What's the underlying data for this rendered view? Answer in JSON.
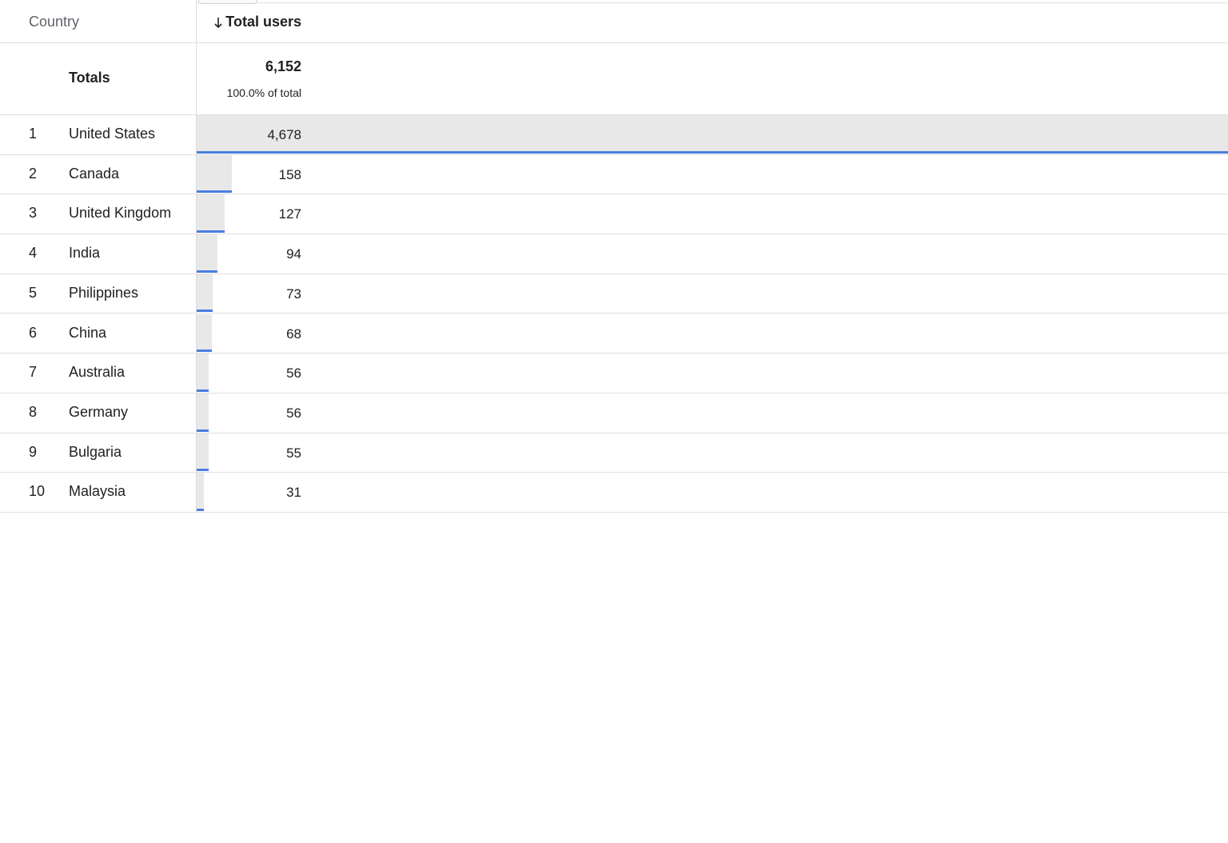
{
  "header": {
    "dimension_label": "Country",
    "metric_label": "Total users",
    "sort_icon": "arrow-down-icon"
  },
  "totals": {
    "label": "Totals",
    "value": "6,152",
    "percent_label": "100.0% of total"
  },
  "rows": [
    {
      "rank": "1",
      "country": "United States",
      "value": "4,678",
      "users": 4678
    },
    {
      "rank": "2",
      "country": "Canada",
      "value": "158",
      "users": 158
    },
    {
      "rank": "3",
      "country": "United Kingdom",
      "value": "127",
      "users": 127
    },
    {
      "rank": "4",
      "country": "India",
      "value": "94",
      "users": 94
    },
    {
      "rank": "5",
      "country": "Philippines",
      "value": "73",
      "users": 73
    },
    {
      "rank": "6",
      "country": "China",
      "value": "68",
      "users": 68
    },
    {
      "rank": "7",
      "country": "Australia",
      "value": "56",
      "users": 56
    },
    {
      "rank": "8",
      "country": "Germany",
      "value": "56",
      "users": 56
    },
    {
      "rank": "9",
      "country": "Bulgaria",
      "value": "55",
      "users": 55
    },
    {
      "rank": "10",
      "country": "Malaysia",
      "value": "31",
      "users": 31
    }
  ],
  "colors": {
    "bar_fill": "#e8e8e8",
    "bar_accent": "#4a7de0"
  }
}
